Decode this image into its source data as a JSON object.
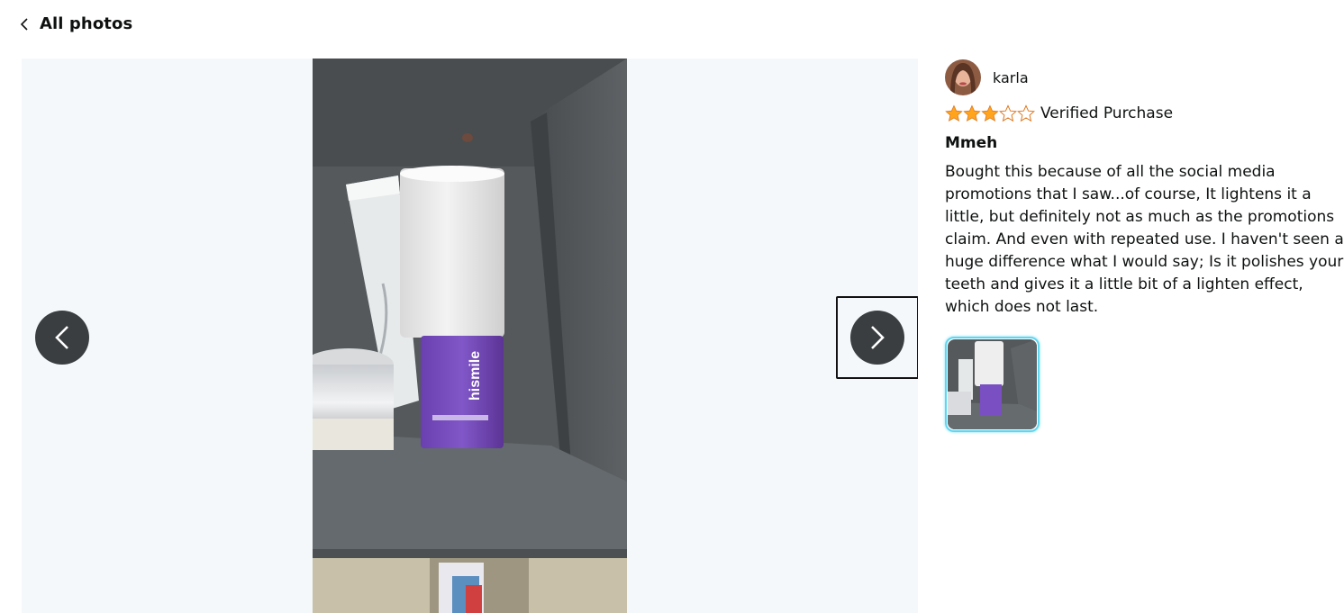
{
  "nav": {
    "back_label": "All photos"
  },
  "review": {
    "reviewer_name": "karla",
    "rating": 3,
    "max_rating": 5,
    "verified_label": "Verified Purchase",
    "title": "Mmeh",
    "body": "Bought this because of all the social media promotions that I saw...of course, It lightens it a little, but definitely not as much as the promotions claim. And even with repeated use. I haven't seen a huge difference what I would say; Is it polishes your teeth and gives it a little bit of a lighten effect, which does not last."
  },
  "product_photo": {
    "brand_text": "hismile"
  },
  "colors": {
    "star": "#ffa41c",
    "nav_button": "#3a3e40",
    "thumb_border": "#5fd6f0"
  }
}
